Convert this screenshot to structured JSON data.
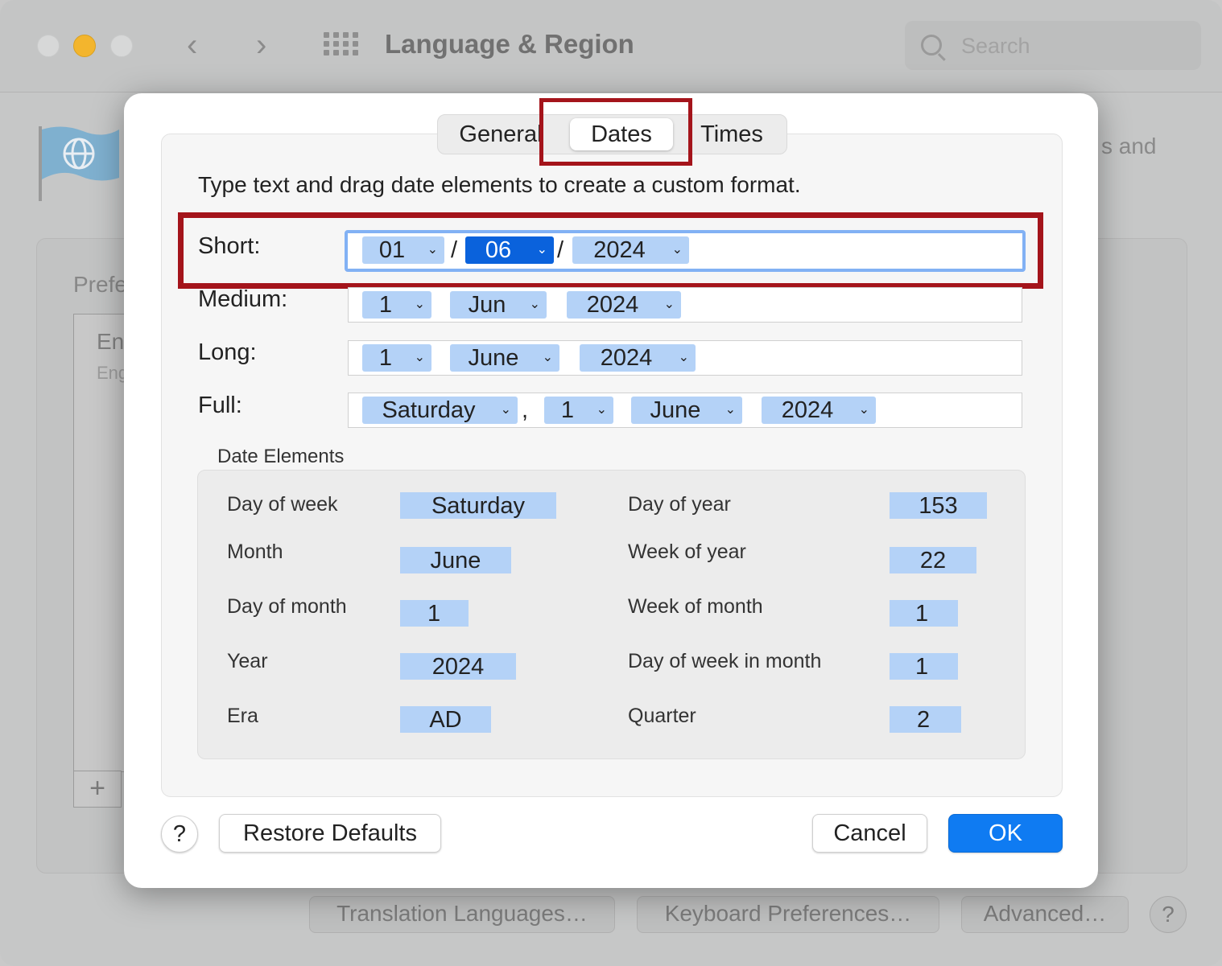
{
  "window": {
    "title": "Language & Region",
    "search_placeholder": "Search"
  },
  "background": {
    "right_text": "s and",
    "pref_label": "Prefe",
    "list_item_title": "En",
    "list_item_sub": "Eng",
    "add_button": "+",
    "buttons": [
      "Translation Languages…",
      "Keyboard Preferences…",
      "Advanced…"
    ],
    "help": "?"
  },
  "dialog": {
    "tabs": {
      "general": "General",
      "dates": "Dates",
      "times": "Times"
    },
    "instruction": "Type text and drag date elements to create a custom format.",
    "formats": {
      "short": {
        "label": "Short:",
        "tokens": [
          "01",
          "06",
          "2024"
        ],
        "seps": [
          "/",
          "/"
        ],
        "selected": "06"
      },
      "medium": {
        "label": "Medium:",
        "tokens": [
          "1",
          "Jun",
          "2024"
        ]
      },
      "long": {
        "label": "Long:",
        "tokens": [
          "1",
          "June",
          "2024"
        ]
      },
      "full": {
        "label": "Full:",
        "tokens": [
          "Saturday",
          "1",
          "June",
          "2024"
        ],
        "seps": [
          ","
        ]
      }
    },
    "date_elements": {
      "title": "Date Elements",
      "left": [
        {
          "label": "Day of week",
          "value": "Saturday"
        },
        {
          "label": "Month",
          "value": "June"
        },
        {
          "label": "Day of month",
          "value": "1"
        },
        {
          "label": "Year",
          "value": "2024"
        },
        {
          "label": "Era",
          "value": "AD"
        }
      ],
      "right": [
        {
          "label": "Day of year",
          "value": "153"
        },
        {
          "label": "Week of year",
          "value": "22"
        },
        {
          "label": "Week of month",
          "value": "1"
        },
        {
          "label": "Day of week in month",
          "value": "1"
        },
        {
          "label": "Quarter",
          "value": "2"
        }
      ]
    },
    "buttons": {
      "help": "?",
      "restore": "Restore Defaults",
      "cancel": "Cancel",
      "ok": "OK"
    }
  },
  "colors": {
    "accent": "#0F7BF2",
    "highlight_box": "#A4141B",
    "token": "#B4D2F7"
  }
}
